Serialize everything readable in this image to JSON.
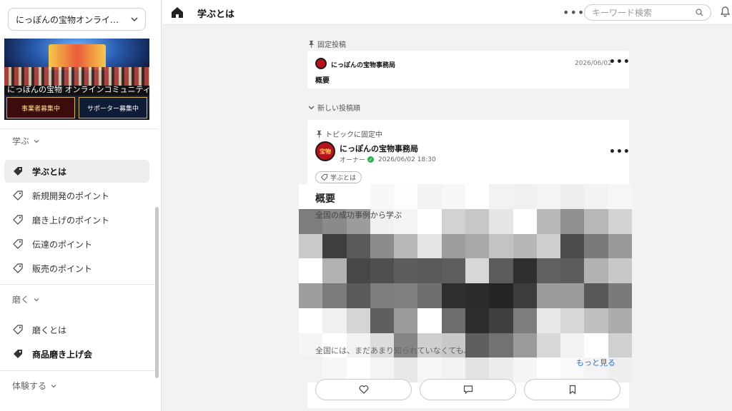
{
  "community": {
    "name": "にっぽんの宝物オンライン…"
  },
  "banner": {
    "title": "にっぽんの宝物 オンラインコミュニティ",
    "box_left": "事業者募集中",
    "box_right": "サポーター募集中"
  },
  "sidebar": {
    "sections": [
      {
        "title": "学ぶ",
        "items": [
          {
            "label": "学ぶとは"
          },
          {
            "label": "新規開発のポイント"
          },
          {
            "label": "磨き上げのポイント"
          },
          {
            "label": "伝達のポイント"
          },
          {
            "label": "販売のポイント"
          }
        ]
      },
      {
        "title": "磨く",
        "items": [
          {
            "label": "磨くとは"
          },
          {
            "label": "商品磨き上げ会"
          }
        ]
      },
      {
        "title": "体験する",
        "items": []
      }
    ]
  },
  "header": {
    "title": "学ぶとは",
    "more": "•••",
    "search_placeholder": "キーワード検索"
  },
  "feed": {
    "pinned_label": "固定投稿",
    "pinned_post": {
      "author": "にっぽんの宝物事務局",
      "date": "2026/06/02",
      "summary": "概要",
      "more": "•••"
    },
    "sort_label": "新しい投稿順",
    "post": {
      "topic_pin": "トピックに固定中",
      "author": "にっぽんの宝物事務局",
      "role": "オーナー",
      "datetime": "2026/06/02 18:30",
      "tag": "学ぶとは",
      "title": "概要",
      "subtitle": "全国の成功事例から学ぶ",
      "excerpt": "全国には、まだあまり知られていなくても、…",
      "more_link": "もっと見る",
      "more": "•••",
      "avatar_text": "宝物"
    }
  }
}
